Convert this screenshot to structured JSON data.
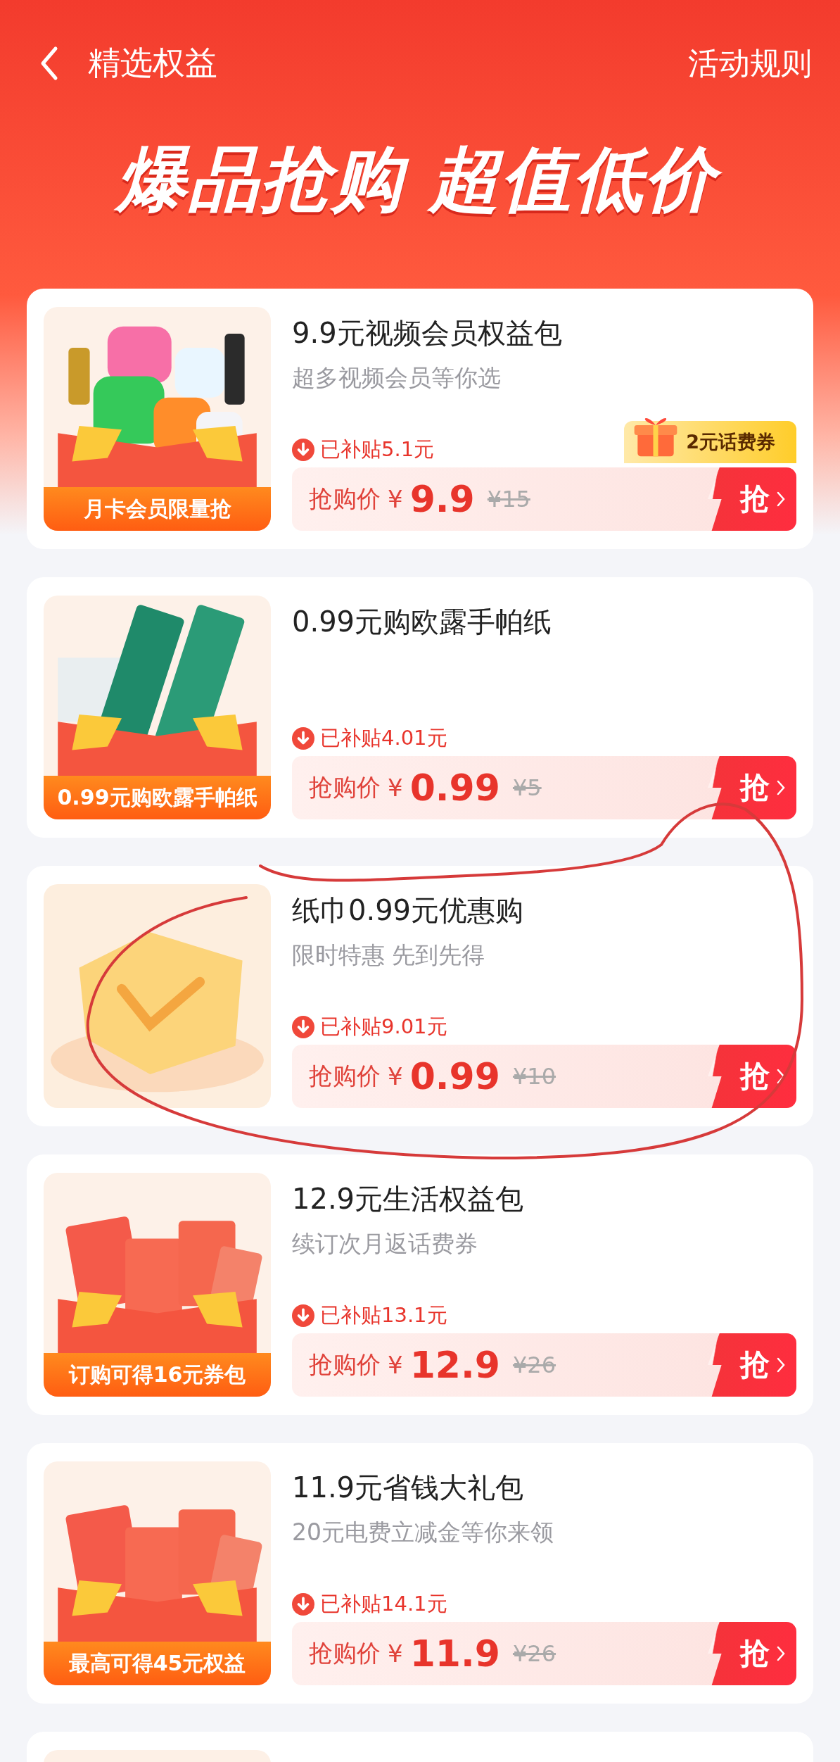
{
  "header": {
    "title": "精选权益",
    "rules_link": "活动规则"
  },
  "banner": {
    "headline": "爆品抢购 超值低价"
  },
  "products": [
    {
      "kind": "video",
      "thumb_caption": "月卡会员限量抢",
      "title": "9.9元视频会员权益包",
      "subtitle": "超多视频会员等你选",
      "badge": "2元话费券",
      "subsidy": "已补贴5.1元",
      "price_label": "抢购价",
      "currency": "¥",
      "price": "9.9",
      "original_price": "¥15",
      "buy_button": "抢"
    },
    {
      "kind": "tissue",
      "thumb_caption": "0.99元购欧露手帕纸",
      "title": "0.99元购欧露手帕纸",
      "subsidy": "已补贴4.01元",
      "price_label": "抢购价",
      "currency": "¥",
      "price": "0.99",
      "original_price": "¥5",
      "buy_button": "抢"
    },
    {
      "kind": "coin",
      "title": "纸巾0.99元优惠购",
      "subtitle": "限时特惠 先到先得",
      "subsidy": "已补贴9.01元",
      "price_label": "抢购价",
      "currency": "¥",
      "price": "0.99",
      "original_price": "¥10",
      "buy_button": "抢"
    },
    {
      "kind": "coupons",
      "thumb_caption": "订购可得16元券包",
      "title": "12.9元生活权益包",
      "subtitle": "续订次月返话费券",
      "subsidy": "已补贴13.1元",
      "price_label": "抢购价",
      "currency": "¥",
      "price": "12.9",
      "original_price": "¥26",
      "buy_button": "抢"
    },
    {
      "kind": "coupons",
      "thumb_caption": "最高可得45元权益",
      "title": "11.9元省钱大礼包",
      "subtitle": "20元电费立减金等你来领",
      "subsidy": "已补贴14.1元",
      "price_label": "抢购价",
      "currency": "¥",
      "price": "11.9",
      "original_price": "¥26",
      "buy_button": "抢"
    },
    {
      "kind": "partial"
    }
  ]
}
